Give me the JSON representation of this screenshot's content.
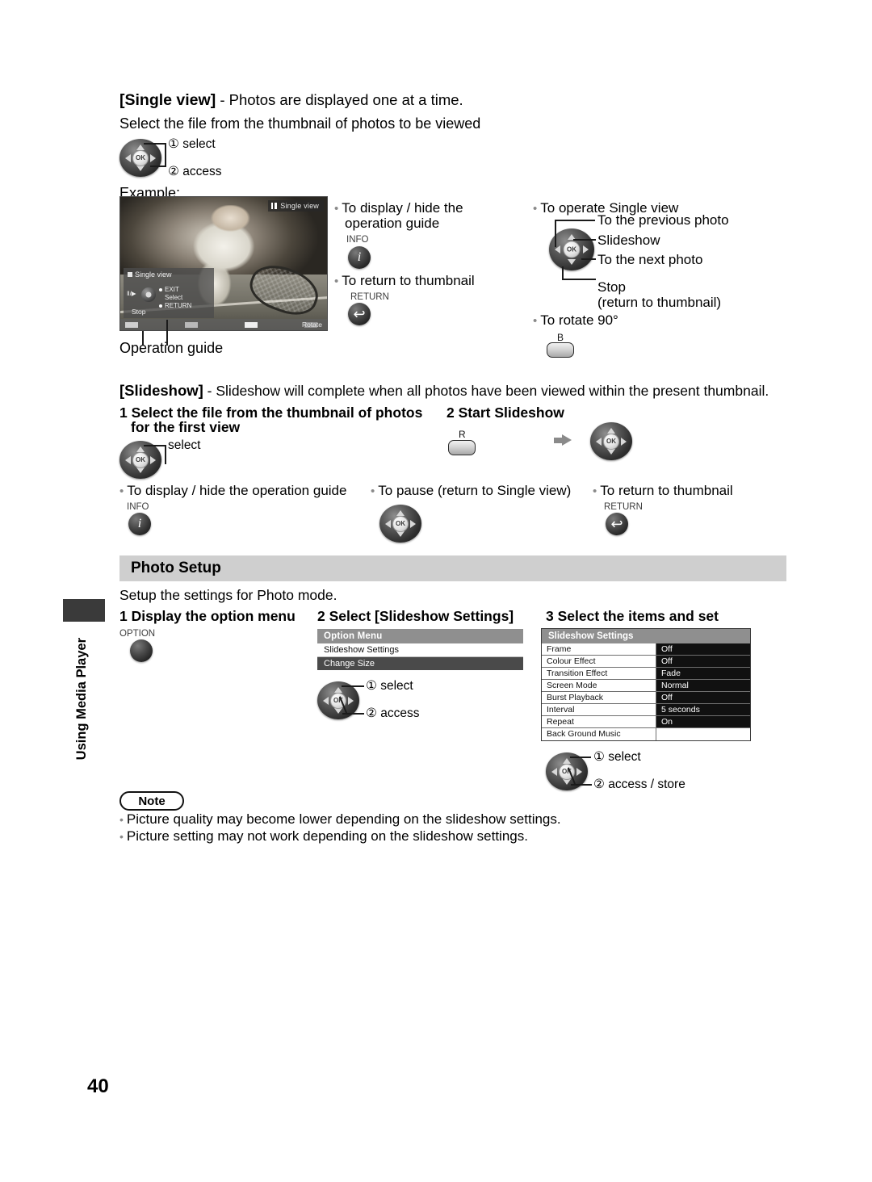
{
  "page": {
    "number": "40",
    "side_tab": "Using Media Player"
  },
  "single_view": {
    "title_bracket": "[Single view]",
    "title_rest": " - Photos are displayed one at a time.",
    "instruction": "Select the file from the thumbnail of photos to be viewed",
    "dpad_callout_1": "① select",
    "dpad_callout_2": "② access",
    "example_label": "Example:",
    "operation_guide_label": "Operation guide",
    "tv": {
      "badge": "Single view",
      "overlay_title": "Single view",
      "overlay_playpause": "Ⅱ/▶",
      "overlay_items": [
        "EXIT",
        "Select",
        "RETURN"
      ],
      "overlay_stop": "Stop",
      "colorbar_rotate": "Rotate"
    },
    "col_mid": {
      "b1_line1": "To display / hide the",
      "b1_line2": "operation guide",
      "info_label": "INFO",
      "info_glyph": "i",
      "b2": "To return to thumbnail",
      "return_label": "RETURN",
      "return_glyph": "↩"
    },
    "col_right": {
      "heading": "To operate Single view",
      "up_label": "To the previous photo",
      "ok_label": "Slideshow",
      "right_label": "To the next photo",
      "down_label": "Stop",
      "down_sub": "(return to thumbnail)",
      "rotate_bullet": "To rotate 90°",
      "rotate_button": "B"
    }
  },
  "slideshow": {
    "title_bracket": "[Slideshow]",
    "title_rest": " - Slideshow will complete when all photos have been viewed within the present thumbnail.",
    "step1_num": "1",
    "step1_line1": "Select the file from the thumbnail of photos",
    "step1_line2": "for the first view",
    "step1_callout": "select",
    "step2_num": "2",
    "step2_title": "Start Slideshow",
    "step2_button": "R",
    "bullets": [
      {
        "text": "To display / hide the operation guide",
        "btn_label": "INFO",
        "btn_glyph": "i"
      },
      {
        "text": "To pause (return to Single view)",
        "btn_label": "",
        "btn_glyph": "OK"
      },
      {
        "text": "To return to thumbnail",
        "btn_label": "RETURN",
        "btn_glyph": "↩"
      }
    ]
  },
  "photo_setup": {
    "band_title": "Photo Setup",
    "intro": "Setup the settings for Photo mode.",
    "step1_num": "1",
    "step1_title": "Display the option menu",
    "option_button_label": "OPTION",
    "step2_num": "2",
    "step2_title": "Select [Slideshow Settings]",
    "option_menu": {
      "title": "Option Menu",
      "items": [
        "Slideshow Settings",
        "Change Size"
      ],
      "selected_index": 1,
      "callout_1": "① select",
      "callout_2": "② access"
    },
    "step3_num": "3",
    "step3_title": "Select the items and set",
    "slideshow_settings": {
      "title": "Slideshow Settings",
      "rows": [
        {
          "key": "Frame",
          "value": "Off"
        },
        {
          "key": "Colour Effect",
          "value": "Off"
        },
        {
          "key": "Transition Effect",
          "value": "Fade"
        },
        {
          "key": "Screen Mode",
          "value": "Normal"
        },
        {
          "key": "Burst Playback",
          "value": "Off"
        },
        {
          "key": "Interval",
          "value": "5 seconds"
        },
        {
          "key": "Repeat",
          "value": "On"
        },
        {
          "key": "Back Ground Music",
          "value": ""
        }
      ],
      "callout_1": "① select",
      "callout_2": "② access / store"
    }
  },
  "note": {
    "badge": "Note",
    "lines": [
      "Picture quality may become lower depending on the slideshow settings.",
      "Picture setting may not work depending on the slideshow settings."
    ]
  }
}
